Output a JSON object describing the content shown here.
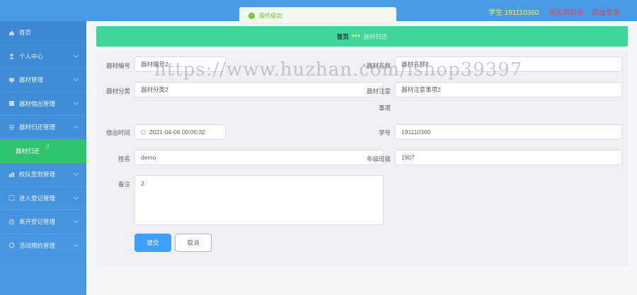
{
  "header": {
    "user_name": "学生 191110360",
    "back_label": "退出到前台",
    "logout_label": "退出登录"
  },
  "toast": {
    "message": "操作成功"
  },
  "sidebar": {
    "items": [
      {
        "label": "首页"
      },
      {
        "label": "个人中心"
      },
      {
        "label": "器材管理"
      },
      {
        "label": "器材借出管理"
      },
      {
        "label": "器材归还管理"
      },
      {
        "label": "器材归还"
      },
      {
        "label": "校队签到管理"
      },
      {
        "label": "进入登记管理"
      },
      {
        "label": "离开登记管理"
      },
      {
        "label": "活动预约管理"
      }
    ]
  },
  "breadcrumb": {
    "home": "首页",
    "hearts": "♥♥♥",
    "current": "器材归还"
  },
  "form": {
    "equipment_no": {
      "label": "器材编号",
      "value": "器材编号2"
    },
    "equipment_name": {
      "label": "器材名称",
      "value": "器材名称2"
    },
    "equipment_category": {
      "label": "器材分类",
      "value": "器材分类2"
    },
    "equipment_notes": {
      "label": "器材注意",
      "label2": "事项",
      "value": "器材注意事项2"
    },
    "borrow_time": {
      "label": "借出时间",
      "value": "2021-04-06 00:06:32"
    },
    "student_no": {
      "label": "学号",
      "value": "191110360"
    },
    "name": {
      "label": "姓名",
      "value": "demo"
    },
    "grade_class": {
      "label": "年级班级",
      "value": "1907"
    },
    "remark": {
      "label": "备注",
      "value": "2"
    },
    "submit_label": "提交",
    "cancel_label": "取消"
  },
  "watermark": "https://www.huzhan.com/ishop39397",
  "colors": {
    "topbar": "#4a9be6",
    "sidebar": "#3d88d2",
    "active_menu": "#2fc36d",
    "breadcrumb_bg": "#3fd797",
    "primary": "#409eff"
  }
}
